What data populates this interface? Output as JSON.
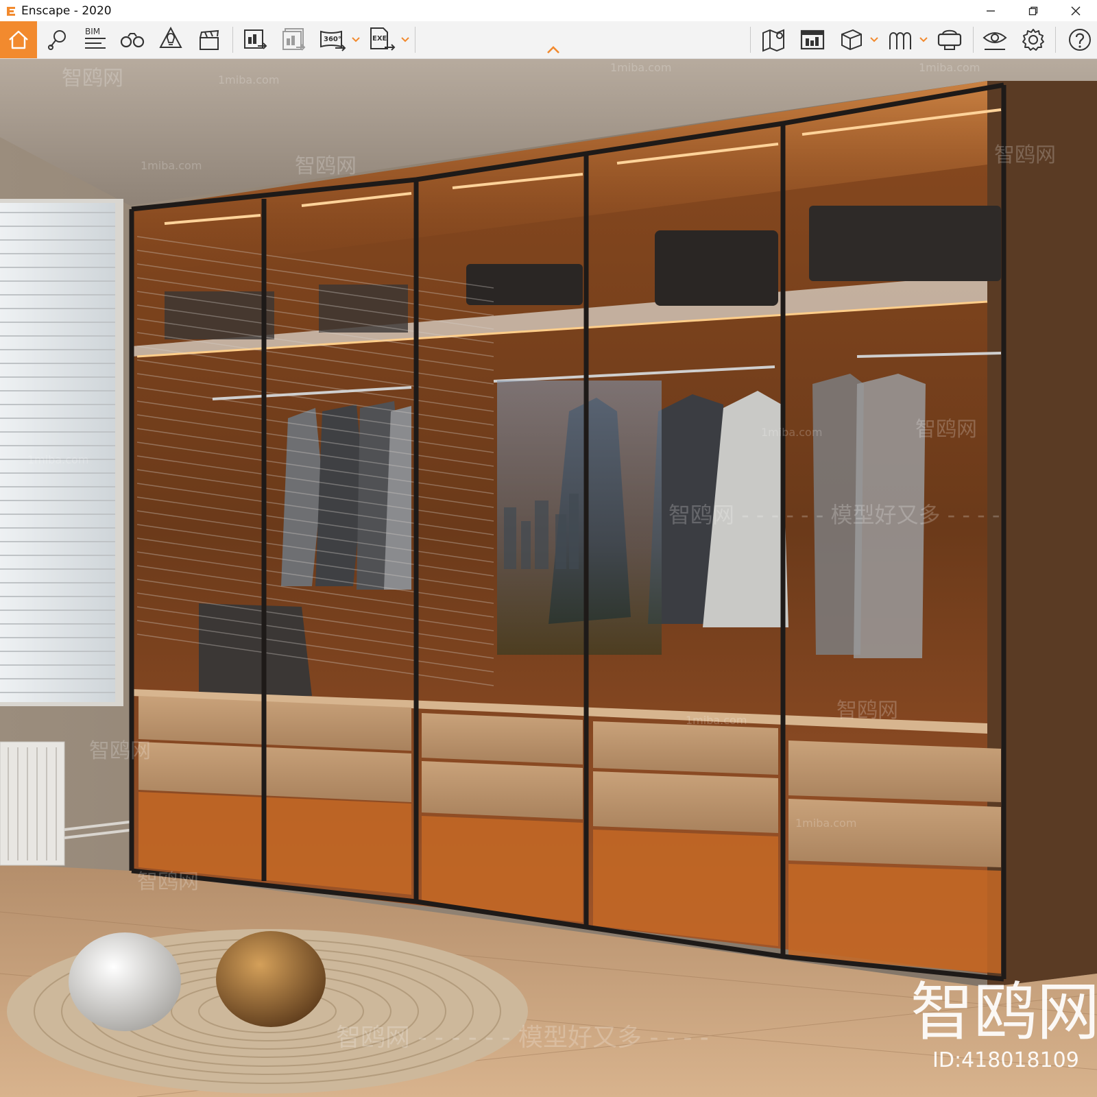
{
  "window": {
    "title": "Enscape - 2020",
    "controls": [
      "minimize",
      "restore",
      "close"
    ]
  },
  "toolbar": {
    "bim_label": "BIM",
    "pano_badge": "360°",
    "exe_badge": "EXE",
    "accent": "#f28a2e",
    "left_tools": [
      "home-icon",
      "map-pin-icon",
      "bim-icon",
      "binoculars-icon",
      "lightbulb-icon",
      "clapperboard-icon",
      "render-screenshot-icon",
      "batch-render-icon",
      "panorama-360-icon",
      "export-exe-icon"
    ],
    "right_tools": [
      "map-icon",
      "view-management-icon",
      "cube-icon",
      "asset-library-icon",
      "vr-headset-icon",
      "visibility-icon",
      "settings-icon",
      "help-icon"
    ]
  },
  "viewport": {
    "scene": "walk-in wardrobe render",
    "watermark_line": "智鸥网 - - - - - - 模型好又多 - - - -",
    "watermark_small": "1miba.com",
    "watermark_chip": "智鸥网",
    "brand_big": "智鸥网",
    "id_label": "ID:418018109"
  }
}
